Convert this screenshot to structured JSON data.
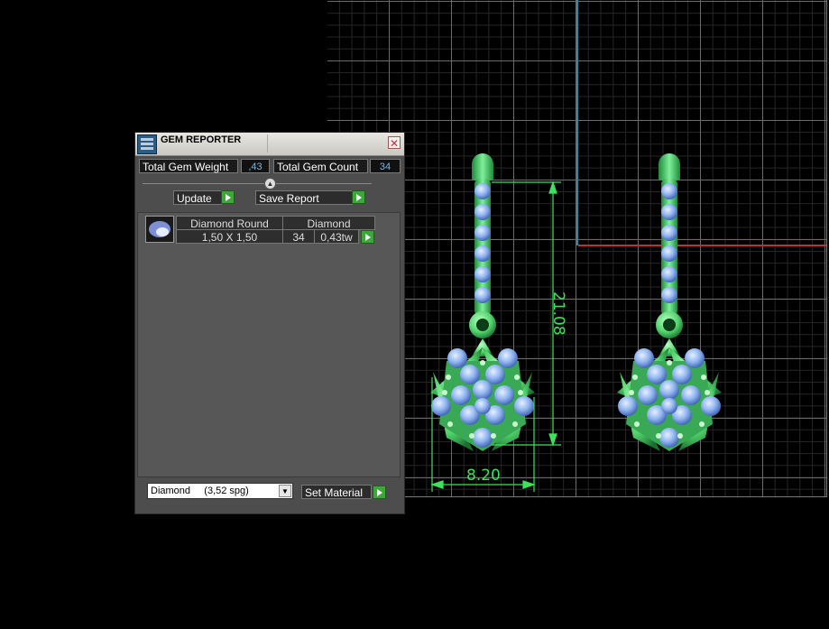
{
  "viewport": {
    "dimension_height": "21.08",
    "dimension_width": "8.20",
    "colors": {
      "metal": "#3fcf6a",
      "gem": "#8fb4f0",
      "dimension": "#3ce25a",
      "axis_y": "#2f8aa0",
      "axis_x": "#b33333"
    }
  },
  "panel": {
    "title": "GEM REPORTER",
    "icons": {
      "app": "gem-reporter-app-icon",
      "close": "close-icon",
      "collapse": "collapse-arrow-icon"
    },
    "total_gem_weight_label": "Total Gem Weight",
    "total_gem_weight_value": ",43",
    "total_gem_count_label": "Total Gem Count",
    "total_gem_count_value": "34",
    "update_label": "Update",
    "save_report_label": "Save Report",
    "gem_row": {
      "thumbnail": "round-gem-thumbnail",
      "shape": "Diamond Round",
      "material": "Diamond",
      "size": "1,50 X 1,50",
      "count": "34",
      "weight": "0,43tw"
    },
    "material_select": {
      "value": "Diamond     (3,52 spg)"
    },
    "set_material_label": "Set Material"
  }
}
